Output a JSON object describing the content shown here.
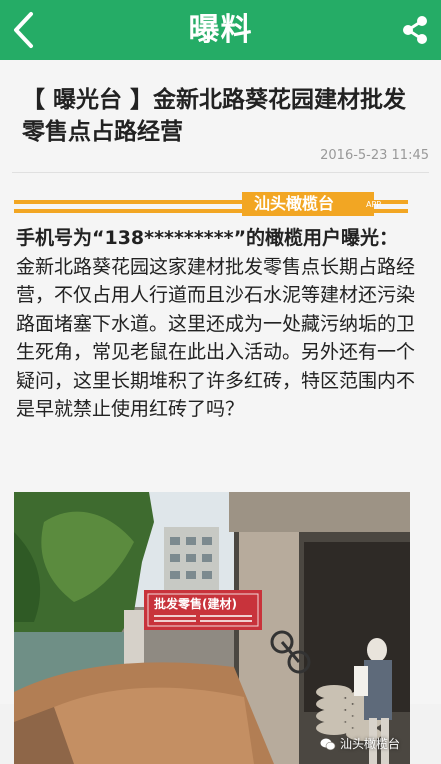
{
  "nav": {
    "title": "曝料",
    "back_icon": "chevron-left-icon",
    "share_icon": "share-icon",
    "bar_color": "#25ac66"
  },
  "article": {
    "headline": "【 曝光台 】金新北路葵花园建材批发零售点占路经营",
    "date": "2016-5-23 11:45",
    "banner_brand": "汕头橄榄台",
    "banner_app": "APP",
    "lead": "手机号为“138*********”的橄榄用户曝光：",
    "body": "金新北路葵花园这家建材批发零售点长期占路经营，不仅占用人行道而且沙石水泥等建材还污染路面堵塞下水道。这里还成为一处藏污纳垢的卫生死角，常见老鼠在此出入活动。另外还有一个疑问，这里长期堆积了许多红砖，特区范围内不是早就禁止使用红砖了吗？",
    "photo": {
      "sign_line1": "批发零售(建材)",
      "watermark": "汕头橄榄台"
    }
  }
}
